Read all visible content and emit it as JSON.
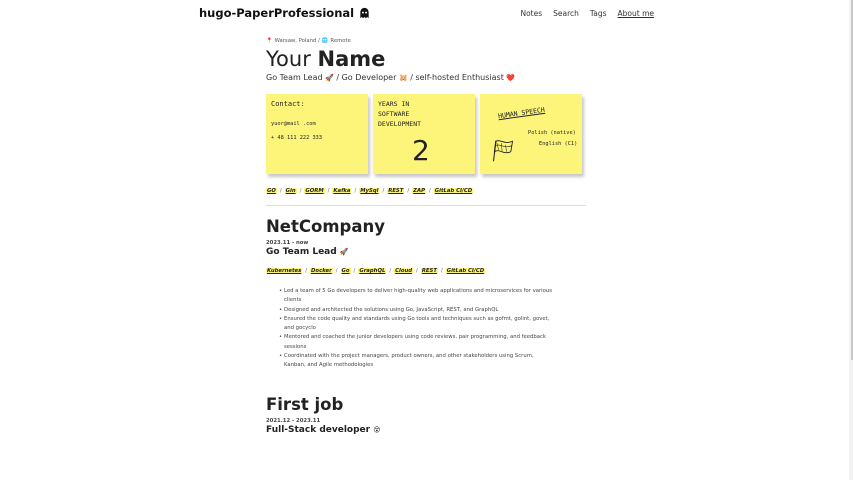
{
  "header": {
    "brand": "hugo-PaperProfessional",
    "brand_icon": "ghost-icon",
    "nav": [
      {
        "label": "Notes",
        "active": false
      },
      {
        "label": "Search",
        "active": false
      },
      {
        "label": "Tags",
        "active": false
      },
      {
        "label": "About me",
        "active": true
      }
    ]
  },
  "profile": {
    "location_pin": "📍",
    "location": "Warsaw, Poland /",
    "remote_icon": "🌐",
    "remote": "Remote",
    "name_prefix": "Your",
    "name_bold": "Name",
    "role1": "Go Team Lead",
    "role1_emoji": "🚀",
    "role2": "/ Go Developer",
    "role2_emoji": "🐹",
    "role3": "/ self-hosted Enthusiast",
    "role3_emoji": "❤️"
  },
  "notes": {
    "contact_title": "Contact:",
    "contact_email": "yuor@mail .com",
    "contact_phone": "+ 48 111 222 333",
    "years_line1": "YEARS IN",
    "years_line2": "SOFTWARE",
    "years_line3": "DEVELOPMENT",
    "years_value": "2",
    "speech_title": "HUMAN SPEECH",
    "speech_lang1": "Polish (native)",
    "speech_lang2": "English (C1)",
    "flag_icon": "flag-icon"
  },
  "skills": [
    "GO",
    "Gin",
    "GORM",
    "Kafka",
    "MySql",
    "REST",
    "ZAP",
    "GitLab CI/CD"
  ],
  "separator": "/",
  "jobs": [
    {
      "company": "NetCompany",
      "period": "2023.11 - now",
      "title": "Go Team Lead",
      "title_emoji": "🚀",
      "tags": [
        "Kubernetes",
        "Docker",
        "Go",
        "GraphQL",
        "Cloud",
        "REST",
        "GitLab CI/CD"
      ],
      "bullets": [
        "Led a team of 5 Go developers to deliver high-quality web applications and microservices for various clients",
        "Designed and architected the solutions using Go, JavaScript, REST, and GraphQL",
        "Ensured the code quality and standards using Go tools and techniques such as gofmt, golint, govet, and gocyclo",
        "Mentored and coached the junior developers using code reviews, pair programming, and feedback sessions",
        "Coordinated with the project managers, product owners, and other stakeholders using Scrum, Kanban, and Agile methodologies"
      ]
    },
    {
      "company": "First job",
      "period": "2021.12 - 2023.11",
      "title": "Full-Stack developer",
      "title_emoji": "😵"
    }
  ]
}
